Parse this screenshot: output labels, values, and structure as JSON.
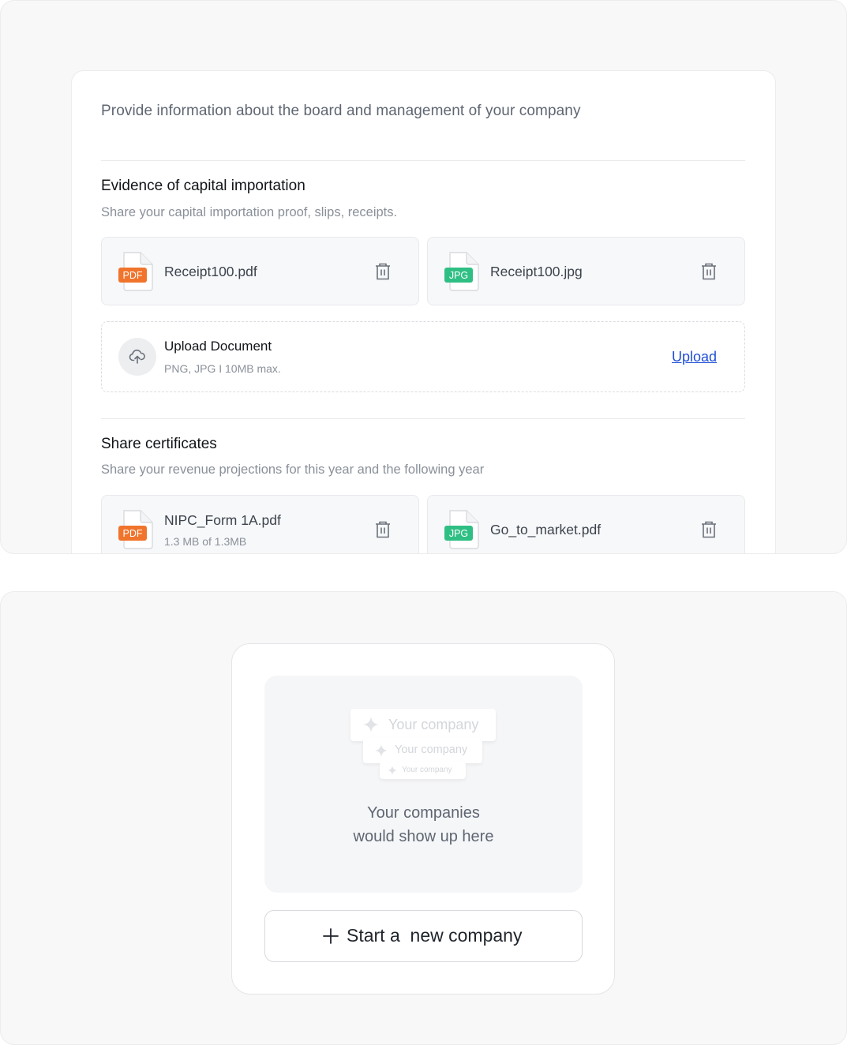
{
  "board_section": {
    "intro": "Provide information about the board and management of your company",
    "capital": {
      "title": "Evidence of capital importation",
      "subtitle": "Share your capital importation proof, slips, receipts.",
      "files": [
        {
          "name": "Receipt100.pdf",
          "type": "PDF"
        },
        {
          "name": "Receipt100.jpg",
          "type": "JPG"
        }
      ]
    },
    "upload": {
      "title": "Upload Document",
      "hint": "PNG, JPG I 10MB max.",
      "link": "Upload"
    },
    "shares": {
      "title": "Share certificates",
      "subtitle": "Share your revenue projections for this year and the following year",
      "files": [
        {
          "name": "NIPC_Form 1A.pdf",
          "type": "PDF",
          "meta": "1.3 MB of 1.3MB"
        },
        {
          "name": "Go_to_market.pdf",
          "type": "JPG"
        }
      ]
    }
  },
  "companies": {
    "chip_label": "Your company",
    "empty_line1": "Your companies",
    "empty_line2": "would show up here",
    "start_button": "Start a  new company"
  },
  "colors": {
    "pdf_badge": "#f0742c",
    "jpg_badge": "#2fbf84",
    "link": "#1f4fd6"
  },
  "icons": {
    "trash": "trash-icon",
    "upload": "cloud-upload-icon",
    "plus": "plus-icon",
    "sparkle": "sparkle-icon"
  }
}
